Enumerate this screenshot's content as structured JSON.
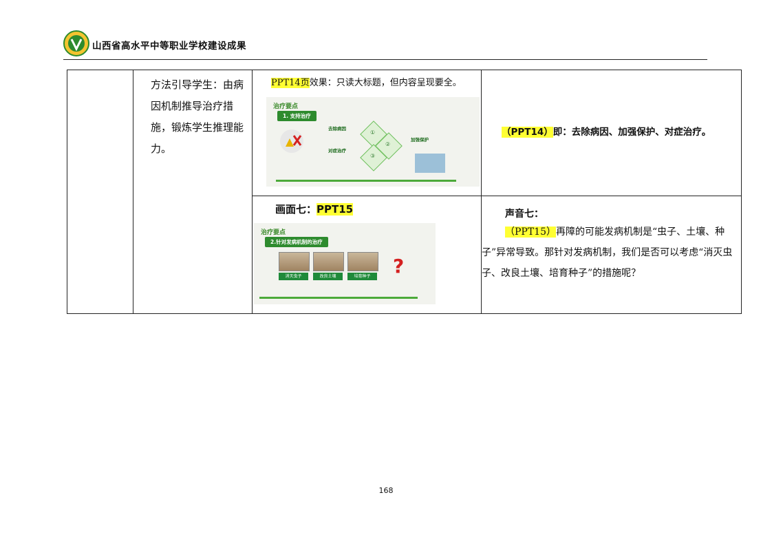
{
  "header": {
    "title": "山西省高水平中等职业学校建设成果",
    "logo_icon": "school-emblem-icon"
  },
  "row1": {
    "method_text": "方法引导学生：由病因机制推导治疗措施，锻炼学生推理能力。",
    "caption_highlight": "PPT14页",
    "caption_rest": "效果：只读大标题，但内容呈现要全。",
    "slide": {
      "title": "治疗要点",
      "subtitle": "1. 支持治疗",
      "item1": "去除病因",
      "item2": "加强保护",
      "item3": "对症治疗",
      "nums": [
        "①",
        "②",
        "③"
      ]
    },
    "answer_highlight": "（PPT14）",
    "answer_rest": "即：去除病因、加强保护、对症治疗。"
  },
  "row2": {
    "caption_prefix": "画面七：",
    "caption_highlight": "PPT15",
    "slide": {
      "title": "治疗要点",
      "subtitle": "2.针对发病机制的治疗",
      "labels": [
        "消灭虫子",
        "改良土壤",
        "培育种子"
      ]
    },
    "sound_title": "声音七：",
    "sound_highlight": "（PPT15）",
    "sound_text": "再障的可能发病机制是“虫子、土壤、种子”异常导致。那针对发病机制，我们是否可以考虑“消灭虫子、改良土壤、培育种子”的措施呢？"
  },
  "page_number": "168",
  "colors": {
    "highlight": "#ffff33",
    "slide_green": "#2e8b2e"
  }
}
